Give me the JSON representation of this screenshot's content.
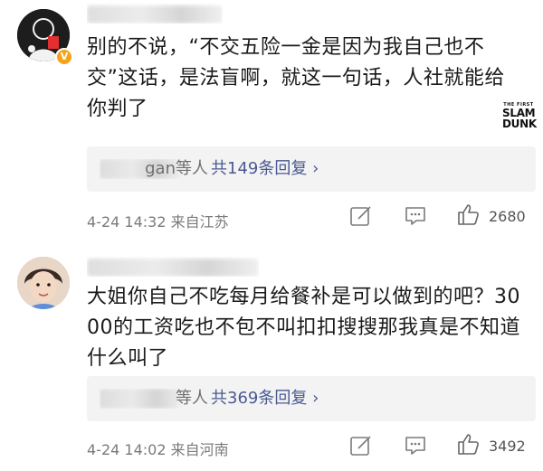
{
  "comments": [
    {
      "verified_badge": "V",
      "text": "别的不说，“不交五险一金是因为我自己也不交”这话，是法盲啊，就这一句话，人社就能给你判了",
      "watermark": {
        "small": "THE FIRST",
        "line1": "SLAM",
        "line2": "DUNK"
      },
      "replies": {
        "names_suffix": "gan等人",
        "count_label": "共149条回复 ›"
      },
      "time_location": "4-24 14:32 来自江苏",
      "likes": "2680"
    },
    {
      "text": "大姐你自己不吃每月给餐补是可以做到的吧？3000的工资吃也不包不叫扣扣搜搜那我真是不知道什么叫了",
      "replies": {
        "names_suffix": "等人",
        "count_label": "共369条回复 ›"
      },
      "time_location": "4-24 14:02 来自河南",
      "likes": "3492"
    }
  ],
  "icons": {
    "share": "share-edit-icon",
    "comment": "comment-bubble-icon",
    "like": "thumbs-up-icon"
  },
  "colors": {
    "reply_link": "#4a5a92",
    "meta_text": "#7a7a7a",
    "reply_bg": "#f3f3f3",
    "badge": "#f7a21b"
  }
}
